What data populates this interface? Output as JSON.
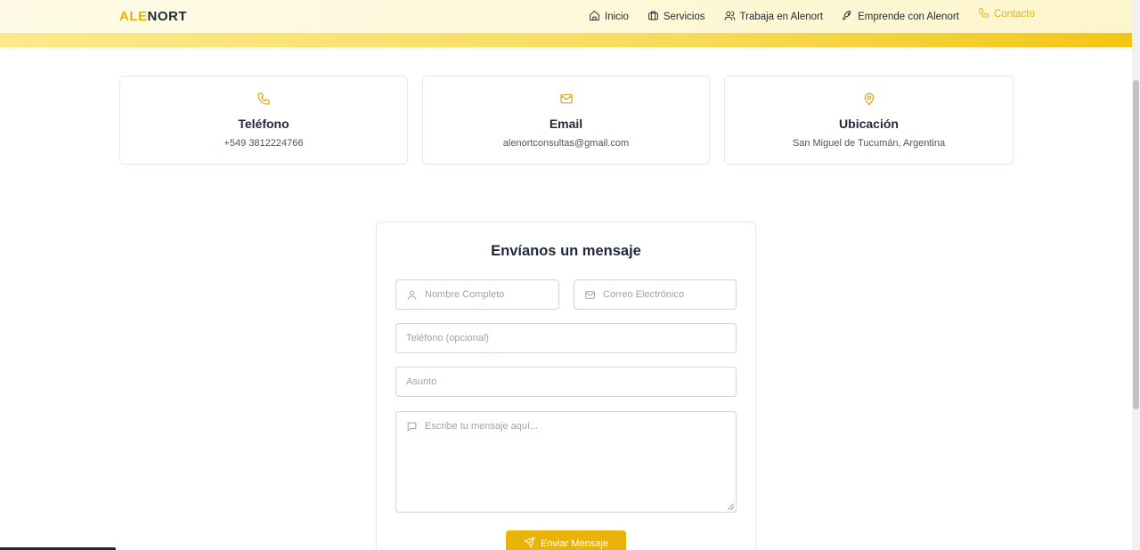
{
  "header": {
    "logo_primary": "ALE",
    "logo_secondary": "NORT",
    "nav": [
      {
        "label": "Inicio",
        "icon": "home-icon"
      },
      {
        "label": "Servicios",
        "icon": "briefcase-icon"
      },
      {
        "label": "Trabaja en Alenort",
        "icon": "users-icon"
      },
      {
        "label": "Emprende con Alenort",
        "icon": "rocket-icon"
      },
      {
        "label": "Contacto",
        "icon": "phone-icon",
        "active": true
      }
    ]
  },
  "contact_cards": [
    {
      "title": "Teléfono",
      "value": "+549 3812224766",
      "icon": "phone-icon"
    },
    {
      "title": "Email",
      "value": "alenortconsultas@gmail.com",
      "icon": "mail-icon"
    },
    {
      "title": "Ubicación",
      "value": "San Miguel de Tucumán, Argentina",
      "icon": "map-pin-icon"
    }
  ],
  "form": {
    "title": "Envíanos un mensaje",
    "name_placeholder": "Nombre Completo",
    "email_placeholder": "Correo Electrónico",
    "phone_placeholder": "Teléfono (opcional)",
    "subject_placeholder": "Asunto",
    "message_placeholder": "Escribe tu mensaje aquí...",
    "submit_label": "Enviar Mensaje"
  },
  "colors": {
    "accent": "#eab308",
    "text": "#1f2937",
    "muted": "#9ca3af"
  }
}
